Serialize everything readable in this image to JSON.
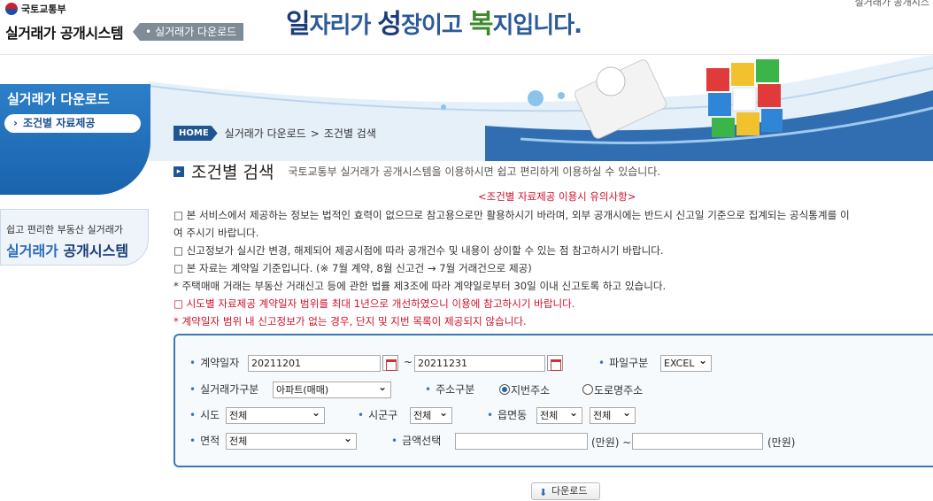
{
  "header": {
    "ministry": "국토교통부",
    "system_name": "실거래가 공개시스템",
    "crumb_tag": "실거래가 다운로드",
    "slogan": {
      "p1": "일",
      "p2": "자리가 ",
      "p3": "성",
      "p4": "장이고 ",
      "p5": "복",
      "p6": "지입니다."
    },
    "top_link": "실거래가 공개시스"
  },
  "sidebar": {
    "title": "실거래가 다운로드",
    "menu_item": "조건별 자료제공",
    "banner_sub": "쉽고 편리한 부동산 실거래가",
    "banner_main_a": "실거래가 ",
    "banner_main_b": "공개시스템"
  },
  "breadcrumb": {
    "home": "HOME",
    "level1": "실거래가 다운로드",
    "sep": ">",
    "level2": "조건별 검색"
  },
  "page": {
    "title": "조건별 검색",
    "description": "국토교통부 실거래가 공개시스템을 이용하시면 쉽고 편리하게 이용하실 수 있습니다."
  },
  "notice": {
    "heading": "<조건별 자료제공 이용시 유의사항>",
    "lines": [
      "□ 본 서비스에서 제공하는 정보는 법적인 효력이 없으므로 참고용으로만 활용하시기 바라며, 외부 공개시에는 반드시 신고일 기준으로 집계되는 공식통계를 이",
      "여 주시기 바랍니다.",
      "□ 신고정보가 실시간 변경, 해제되어 제공시점에 따라 공개건수 및 내용이 상이할 수 있는 점 참고하시기 바랍니다.",
      "□ 본 자료는 계약일 기준입니다. (※ 7월 계약, 8월 신고건 → 7월 거래건으로 제공)",
      "* 주택매매 거래는 부동산 거래신고 등에 관한 법률 제3조에 따라 계약일로부터 30일 이내 신고토록 하고 있습니다.",
      "□ 시도별 자료제공 계약일자 범위를 최대 1년으로 개선하였으니 이용에 참고하시기 바랍니다.",
      "* 계약일자 범위 내 신고정보가 없는 경우, 단지 및 지번 목록이 제공되지 않습니다."
    ]
  },
  "form": {
    "contract_date_label": "계약일자",
    "date_from": "20211201",
    "tilde": "~",
    "date_to": "20211231",
    "file_type_label": "파일구분",
    "file_type_value": "EXCEL",
    "price_type_label": "실거래가구분",
    "price_type_value": "아파트(매매)",
    "address_type_label": "주소구분",
    "address_jibun": "지번주소",
    "address_road": "도로명주소",
    "sido_label": "시도",
    "sido_value": "전체",
    "sigungu_label": "시군구",
    "sigungu_value": "전체",
    "emd_label": "읍면동",
    "emd_value1": "전체",
    "emd_value2": "전체",
    "area_label": "면적",
    "area_value": "전체",
    "amount_label": "금액선택",
    "amount_from": "",
    "amount_to": "",
    "unit_from": "(만원) ~",
    "unit_to": "(만원)"
  },
  "download_button": "다운로드"
}
